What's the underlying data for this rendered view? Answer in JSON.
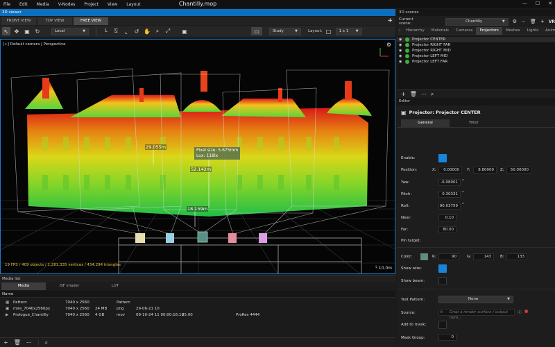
{
  "menu": {
    "items": [
      "File",
      "Edit",
      "Media",
      "V-Nodes",
      "Project",
      "View",
      "Layout"
    ],
    "doc_title": "Chantilly.mop",
    "window_controls": [
      "—",
      "☐",
      "✕"
    ]
  },
  "viewer": {
    "panel_title": "3D viewer",
    "tabs": [
      "FRONT VIEW",
      "TOP VIEW",
      "FREE VIEW"
    ],
    "active_tab": "FREE VIEW",
    "add_tab_label": "+",
    "space_dropdown": "Local",
    "mode_dropdown": "Study",
    "layout_label": "Layout:",
    "layout_dropdown": "1 x 1",
    "camera_label": "[+] Default camera | Perspective",
    "stats": "19 FPS / 409 objects / 1,281,335 vertices / 434,294 triangles",
    "scale": "10.0m",
    "measure_1": "29.055m",
    "measure_2": "52.142m",
    "measure_3": "18.159m",
    "tooltip_line1": "Pixel size: 5.675mm",
    "tooltip_line2": "Lux: 118lx"
  },
  "media": {
    "panel_title": "Media list",
    "tabs": [
      "Media",
      "ISF shader",
      "LUT"
    ],
    "active_tab": "Media",
    "column_name": "Name",
    "rows": [
      {
        "name": "Pattern",
        "res": "7040 x 2560",
        "size": "",
        "type": "Pattern",
        "date": "",
        "fps": "",
        "codec": ""
      },
      {
        "name": "mire_7040x2560px",
        "res": "7040 x 2560",
        "size": "24 MB",
        "type": "png",
        "date": "29-06-21 10",
        "fps": "",
        "codec": ""
      },
      {
        "name": "Prologue_Chantilly",
        "res": "7040 x 2560",
        "size": "4 GB",
        "type": "mov",
        "date": "09-10-24 11    00:00:16:19",
        "fps": "25.00",
        "codec": "ProRes 4444"
      }
    ]
  },
  "scenes": {
    "panel_title": "3D scenes",
    "current_scene_label": "Current scene:",
    "current_scene": "Chantilly",
    "vr_label": "VR",
    "tabs": [
      "Hierarchy",
      "Materials",
      "Cameras",
      "Projectors",
      "Meshes",
      "Lights",
      "Anim"
    ],
    "active_tab": "Projectors",
    "projectors": [
      "Projector CENTER",
      "Projector RIGHT FAR",
      "Projector RIGHT MID",
      "Projector LEFT MID",
      "Projector LEFT FAR"
    ]
  },
  "editor": {
    "panel_title": "Editor",
    "heading": "Projector: Projector CENTER",
    "tabs": [
      "General",
      "Filter"
    ],
    "active_tab": "General",
    "enable_label": "Enable:",
    "position_label": "Position:",
    "pos_x_label": "X:",
    "pos_x": "0.00000",
    "pos_y_label": "Y:",
    "pos_y": "8.80000",
    "pos_z_label": "Z:",
    "pos_z": "50.00000",
    "yaw_label": "Yaw:",
    "yaw": "-6.08001",
    "pitch_label": "Pitch:",
    "pitch": "0.30331",
    "roll_label": "Roll:",
    "roll": "90.03759",
    "deg": "°",
    "near_label": "Near:",
    "near": "0.10",
    "far_label": "Far:",
    "far": "80.00",
    "pin_target_label": "Pin target:",
    "color_label": "Color:",
    "r_label": "R:",
    "r": "90",
    "g_label": "G:",
    "g": "143",
    "b_label": "B:",
    "b": "133",
    "show_wire_label": "Show wire:",
    "show_beam_label": "Show beam:",
    "test_pattern_label": "Test Pattern:",
    "test_pattern": "None",
    "source_label": "Source:",
    "source_placeholder": "Drop a render surface / output here...",
    "add_mask_label": "Add to mask:",
    "mask_group_label": "Mask Group:",
    "mask_group": "0",
    "color_hex": "#5a8f85"
  }
}
